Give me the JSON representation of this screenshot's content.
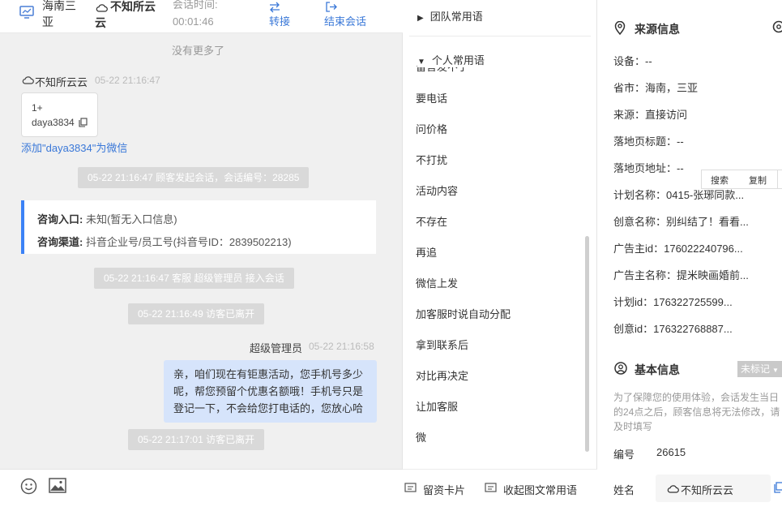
{
  "header": {
    "location": "海南三亚",
    "visitor_name": "不知所云云",
    "duration_label": "会话时间:",
    "duration_value": "00:01:46",
    "transfer_label": "转接",
    "end_label": "结束会话"
  },
  "chat": {
    "no_more": "没有更多了",
    "visitor_msg_name": "不知所云云",
    "visitor_msg_time": "05-22 21:16:47",
    "card_line1": "1+",
    "card_line2": "daya3834",
    "add_wechat": "添加\"daya3834\"为微信",
    "sys1": "05-22 21:16:47 顾客发起会话，会话编号：28285",
    "info_entry_label": "咨询入口:",
    "info_entry_value": " 未知(暂无入口信息)",
    "info_channel_label": "咨询渠道:",
    "info_channel_value": " 抖音企业号/员工号(抖音号ID：2839502213)",
    "sys2": "05-22 21:16:47 客服 超级管理员 接入会话",
    "sys3": "05-22 21:16:49 访客已离开",
    "agent_name": "超级管理员",
    "agent_time": "05-22 21:16:58",
    "agent_msg": "亲，咱们现在有钜惠活动，您手机号多少呢，帮您预留个优惠名额哦！手机号只是登记一下，不会给您打电话的，您放心哈",
    "sys4": "05-22 21:17:01 访客已离开"
  },
  "phrases": {
    "team_group": "团队常用语",
    "personal_group": "个人常用语",
    "items": [
      "要电话",
      "问价格",
      "不打扰",
      "活动内容",
      "不存在",
      "再追",
      "微信上发",
      "加客服时说自动分配",
      "拿到联系后",
      "对比再决定",
      "让加客服",
      "微"
    ],
    "card_btn": "留资卡片",
    "collapse_btn": "收起图文常用语"
  },
  "info": {
    "source_title": "来源信息",
    "device": "设备：--",
    "province": "省市：海南，三亚",
    "source": "来源：直接访问",
    "landing_title": "落地页标题：--",
    "landing_url": "落地页地址：--",
    "plan_name": "计划名称：0415-张琊同款...",
    "creative_name": "创意名称：别纠结了！看看...",
    "advertiser_id": "广告主id：176022240796...",
    "advertiser_name": "广告主名称：提米映画婚前...",
    "plan_id": "计划id：176322725599...",
    "creative_id": "创意id：176322768887...",
    "menu_search": "搜索",
    "menu_copy": "复制",
    "basic_title": "基本信息",
    "tag_label": "未标记",
    "notice": "为了保障您的使用体验，会话发生当日的24点之后，顾客信息将无法修改，请及时填写",
    "id_label": "编号",
    "id_value": "26615",
    "name_label": "姓名",
    "name_value": "不知所云云"
  }
}
